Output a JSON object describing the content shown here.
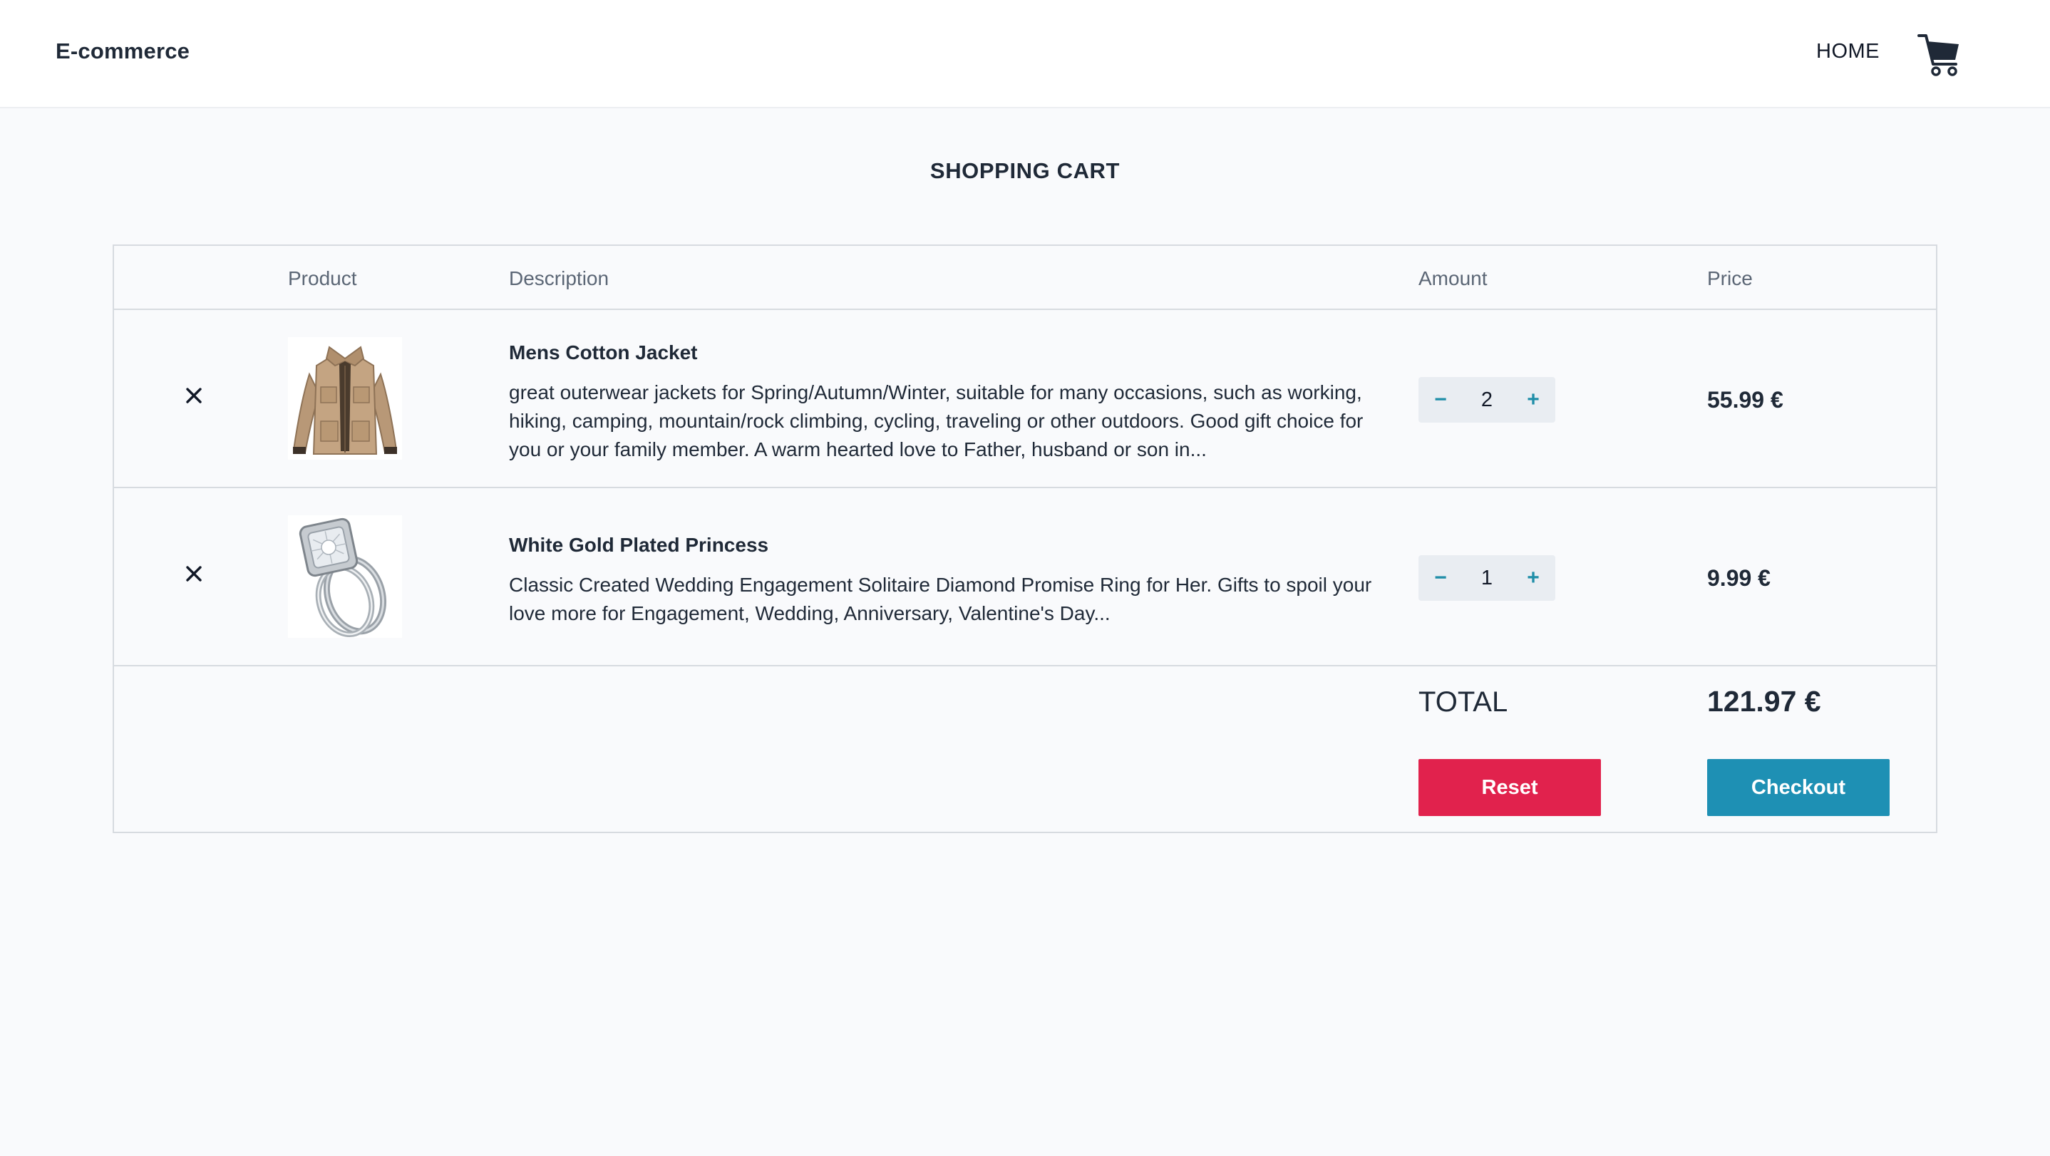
{
  "header": {
    "brand": "E-commerce",
    "nav_home": "HOME",
    "cart_icon": "shopping-cart-icon"
  },
  "page": {
    "title": "SHOPPING CART"
  },
  "table": {
    "columns": [
      "",
      "Product",
      "Description",
      "Amount",
      "Price"
    ]
  },
  "cart": {
    "items": [
      {
        "remove_icon": "close-icon",
        "image": "jacket-image",
        "name": "Mens Cotton Jacket",
        "description": "great outerwear jackets for Spring/Autumn/Winter, suitable for many occasions, such as working, hiking, camping, mountain/rock climbing, cycling, traveling or other outdoors. Good gift choice for you or your family member. A warm hearted love to Father, husband or son in...",
        "decrement": "−",
        "quantity": "2",
        "increment": "+",
        "price": "55.99 €"
      },
      {
        "remove_icon": "close-icon",
        "image": "ring-image",
        "name": "White Gold Plated Princess",
        "description": "Classic Created Wedding Engagement Solitaire Diamond Promise Ring for Her. Gifts to spoil your love more for Engagement, Wedding, Anniversary, Valentine's Day...",
        "decrement": "−",
        "quantity": "1",
        "increment": "+",
        "price": "9.99 €"
      }
    ],
    "total_label": "TOTAL",
    "total_value": "121.97 €",
    "reset_label": "Reset",
    "checkout_label": "Checkout"
  },
  "colors": {
    "accent": "#1e90b4",
    "danger": "#e1224d",
    "background": "#f9fafc",
    "border": "#d7dbe0"
  }
}
